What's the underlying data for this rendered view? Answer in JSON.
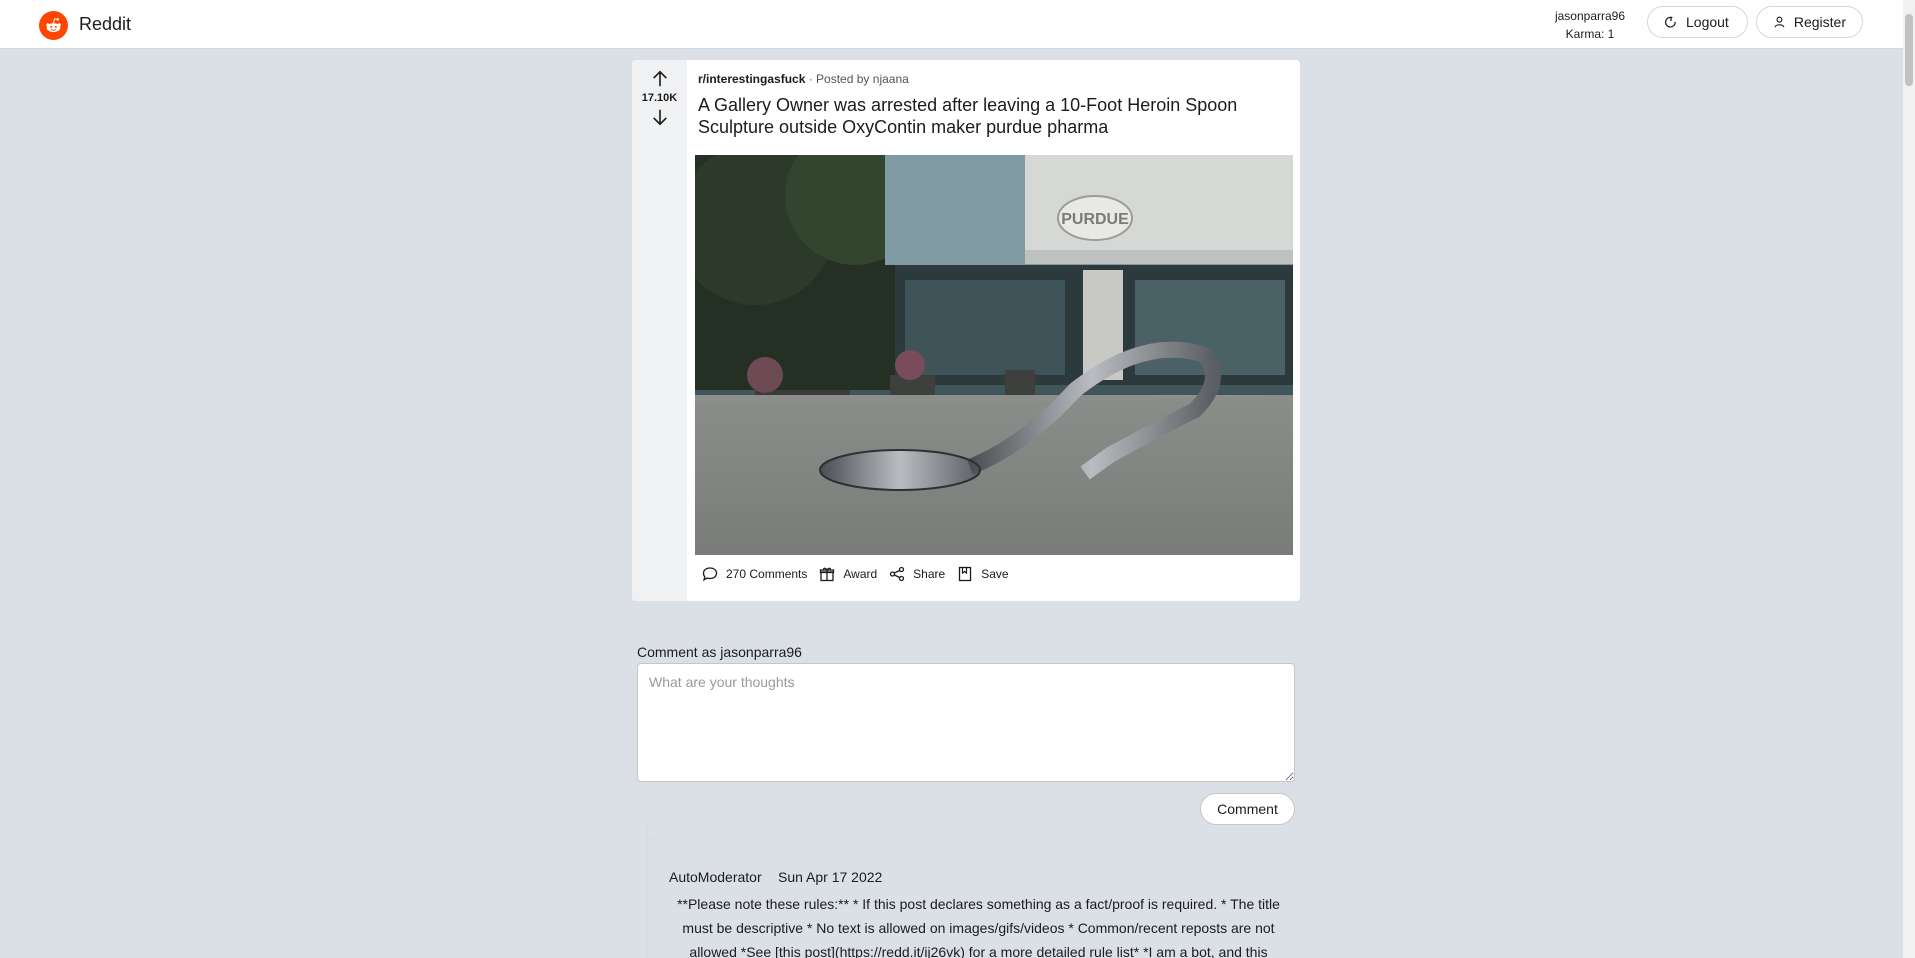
{
  "header": {
    "brand": "Reddit",
    "username": "jasonparra96",
    "karma": "Karma: 1",
    "logout_label": "Logout",
    "register_label": "Register"
  },
  "post": {
    "subreddit": "r/interestingasfuck",
    "posted_by_prefix": "· Posted by",
    "author": "njaana",
    "score": "17.10K",
    "title": "A Gallery Owner was arrested after leaving a 10-Foot Heroin Spoon Sculpture outside OxyContin maker purdue pharma",
    "image_sign_text": "PURDUE",
    "actions": {
      "comments": "270 Comments",
      "award": "Award",
      "share": "Share",
      "save": "Save"
    }
  },
  "composer": {
    "label": "Comment as jasonparra96",
    "placeholder": "What are your thoughts",
    "submit_label": "Comment"
  },
  "comments": [
    {
      "author": "AutoModerator",
      "date": "Sun Apr 17 2022",
      "body": "**Please note these rules:** * If this post declares something as a fact/proof is required. * The title must be descriptive * No text is allowed on images/gifs/videos * Common/recent reposts are not allowed *See [this post](https://redd.it/ij26vk) for a more detailed rule list* *I am a bot, and this"
    }
  ],
  "colors": {
    "brand": "#ff4500",
    "page_bg": "#dae0e6"
  },
  "icons": [
    "reddit-logo-icon",
    "logout-icon",
    "user-icon",
    "upvote-arrow-icon",
    "downvote-arrow-icon",
    "comment-bubble-icon",
    "gift-icon",
    "share-icon",
    "bookmark-icon"
  ]
}
